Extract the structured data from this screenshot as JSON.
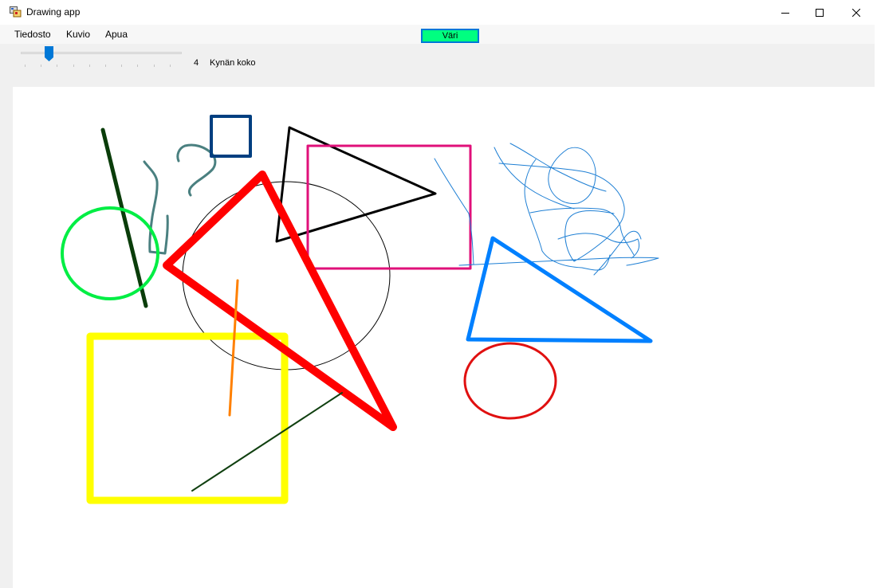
{
  "window": {
    "title": "Drawing app",
    "icons": {
      "app": "app-icon",
      "minimize": "minimize-icon",
      "maximize": "maximize-icon",
      "close": "close-icon"
    }
  },
  "menu": {
    "items": [
      {
        "label": "Tiedosto"
      },
      {
        "label": "Kuvio"
      },
      {
        "label": "Apua"
      }
    ]
  },
  "toolbar": {
    "color_button": {
      "label": "Väri",
      "color": "#00ff80"
    },
    "pen_size": {
      "value": "4",
      "label": "Kynän koko",
      "min": 1,
      "max": 20,
      "level": 4
    }
  },
  "canvas": {
    "background": "#ffffff",
    "stroke_colors": [
      "#0a3d0a",
      "#4a8080",
      "#003f80",
      "#000000",
      "#e0107a",
      "#ff0000",
      "#00ee44",
      "#1e7fd4",
      "#0080ff",
      "#ff8000",
      "#ffff00",
      "#104010",
      "#e01010"
    ]
  }
}
